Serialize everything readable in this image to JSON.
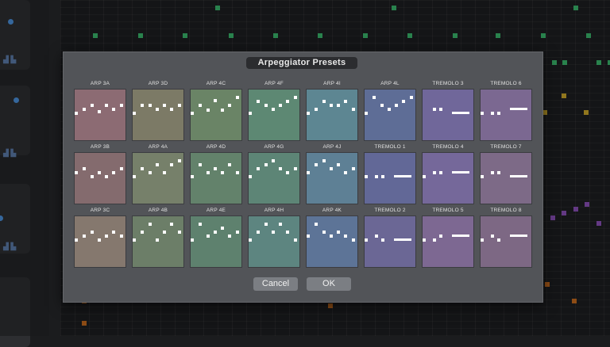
{
  "dialog": {
    "title": "Arpeggiator Presets",
    "cancel_label": "Cancel",
    "ok_label": "OK"
  },
  "presets": [
    [
      {
        "label": "ARP 3A",
        "color": "#8c6b73",
        "pattern": "arp3a"
      },
      {
        "label": "ARP 3D",
        "color": "#7c7a66",
        "pattern": "arp3d"
      },
      {
        "label": "ARP 4C",
        "color": "#6a8466",
        "pattern": "arp4c"
      },
      {
        "label": "ARP 4F",
        "color": "#5d8873",
        "pattern": "arp4f"
      },
      {
        "label": "ARP 4I",
        "color": "#5d8692",
        "pattern": "arp4i"
      },
      {
        "label": "ARP 4L",
        "color": "#5e6d96",
        "pattern": "arp4l"
      },
      {
        "label": "TREMOLO 3",
        "color": "#70679a",
        "pattern": "trem3"
      },
      {
        "label": "TREMOLO 6",
        "color": "#7b6891",
        "pattern": "trem6"
      }
    ],
    [
      {
        "label": "ARP 3B",
        "color": "#846b6e",
        "pattern": "arp3b"
      },
      {
        "label": "ARP 4A",
        "color": "#76806a",
        "pattern": "arp4a"
      },
      {
        "label": "ARP 4D",
        "color": "#63826b",
        "pattern": "arp4d"
      },
      {
        "label": "ARP 4G",
        "color": "#5d8576",
        "pattern": "arp4g"
      },
      {
        "label": "ARP 4J",
        "color": "#5e8095",
        "pattern": "arp4j"
      },
      {
        "label": "TREMOLO 1",
        "color": "#626897",
        "pattern": "trem1"
      },
      {
        "label": "TREMOLO 4",
        "color": "#75689a",
        "pattern": "trem4"
      },
      {
        "label": "TREMOLO 7",
        "color": "#7d6a87",
        "pattern": "trem7"
      }
    ],
    [
      {
        "label": "ARP 3C",
        "color": "#85786e",
        "pattern": "arp3c"
      },
      {
        "label": "ARP 4B",
        "color": "#6c7e68",
        "pattern": "arp4b"
      },
      {
        "label": "ARP 4E",
        "color": "#5e816e",
        "pattern": "arp4e"
      },
      {
        "label": "ARP 4H",
        "color": "#5d8580",
        "pattern": "arp4h"
      },
      {
        "label": "ARP 4K",
        "color": "#5d7497",
        "pattern": "arp4k"
      },
      {
        "label": "TREMOLO 2",
        "color": "#6b6795",
        "pattern": "trem2"
      },
      {
        "label": "TREMOLO 5",
        "color": "#7d6892",
        "pattern": "trem5"
      },
      {
        "label": "TREMOLO 8",
        "color": "#7d6884",
        "pattern": "trem8"
      }
    ]
  ],
  "notes": {
    "green": "#3ab56b",
    "yellow": "#c9a52a",
    "purple": "#8a4fb8",
    "orange": "#c46a1e"
  }
}
